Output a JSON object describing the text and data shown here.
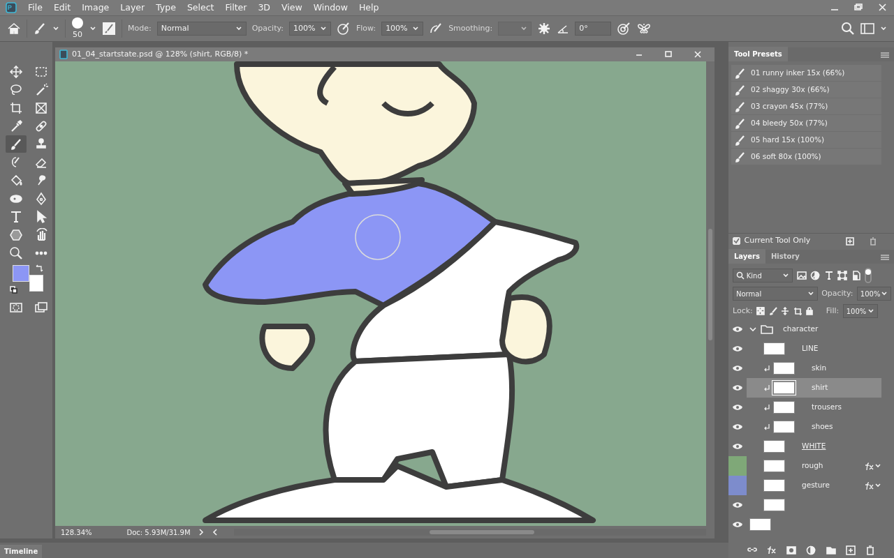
{
  "menu": [
    "File",
    "Edit",
    "Image",
    "Layer",
    "Type",
    "Select",
    "Filter",
    "3D",
    "View",
    "Window",
    "Help"
  ],
  "options": {
    "brush_size": "50",
    "mode_label": "Mode:",
    "mode": "Normal",
    "opacity_label": "Opacity:",
    "opacity": "100%",
    "flow_label": "Flow:",
    "flow": "100%",
    "smoothing_label": "Smoothing:",
    "angle": "0°"
  },
  "tools": [
    {
      "selected": false
    },
    {
      "selected": false
    },
    {
      "selected": false
    },
    {
      "selected": false
    },
    {
      "selected": false
    },
    {
      "selected": false
    },
    {
      "selected": false
    },
    {
      "selected": false
    },
    {
      "selected": true
    },
    {
      "selected": false
    },
    {
      "selected": false
    },
    {
      "selected": false
    },
    {
      "selected": false
    },
    {
      "selected": false
    },
    {
      "selected": false
    },
    {
      "selected": false
    },
    {
      "selected": false
    },
    {
      "selected": false
    },
    {
      "selected": false
    },
    {
      "selected": false
    },
    {
      "selected": false
    },
    {
      "selected": false
    }
  ],
  "swatches": [
    {
      "kind": "foreground",
      "color": "#8c96f5"
    },
    {
      "kind": "background",
      "color": "#ffffff"
    }
  ],
  "document": {
    "title": "01_04_startstate.psd @ 128% (shirt, RGB/8) *",
    "zoom": "128.34%",
    "doc_size": "Doc: 5.93M/31.9M"
  },
  "timeline": {
    "label": "Timeline"
  },
  "tool_presets": {
    "title": "Tool Presets",
    "items": [
      {
        "label": "01 runny inker 15x (66%)"
      },
      {
        "label": "02 shaggy 30x (66%)"
      },
      {
        "label": "03 crayon 45x (77%)"
      },
      {
        "label": "04 bleedy 50x (77%)"
      },
      {
        "label": "05 hard 15x (100%)"
      },
      {
        "label": "06 soft 80x (100%)"
      }
    ],
    "current_tool_only": {
      "label": "Current Tool Only",
      "checked": true
    }
  },
  "layers_panel": {
    "tabs": [
      {
        "label": "Layers",
        "selected": true
      },
      {
        "label": "History",
        "selected": false
      }
    ],
    "filter": "Kind",
    "blend_mode": "Normal",
    "opacity_label": "Opacity:",
    "opacity": "100%",
    "lock_label": "Lock:",
    "fill_label": "Fill:",
    "fill": "100%",
    "layers": [
      {
        "kind": "group",
        "name": "character",
        "visible": true,
        "expanded": true,
        "selected": false,
        "children": [
          {
            "kind": "layer",
            "name": "LINE",
            "visible": true,
            "selected": false,
            "clipped": false
          },
          {
            "kind": "layer",
            "name": "skin",
            "visible": true,
            "selected": false,
            "clipped": true
          },
          {
            "kind": "layer",
            "name": "shirt",
            "visible": true,
            "selected": true,
            "clipped": true
          },
          {
            "kind": "layer",
            "name": "trousers",
            "visible": true,
            "selected": false,
            "clipped": true
          },
          {
            "kind": "layer",
            "name": "shoes",
            "visible": true,
            "selected": false,
            "clipped": true
          },
          {
            "kind": "layer",
            "name": "WHITE",
            "visible": true,
            "selected": false,
            "clipped": false,
            "underlined": true
          },
          {
            "kind": "layer",
            "name": "rough",
            "visible": false,
            "selected": false,
            "clipped": false,
            "fx": true,
            "color": "#7fa878"
          },
          {
            "kind": "layer",
            "name": "gesture",
            "visible": false,
            "selected": false,
            "clipped": false,
            "fx": true,
            "color": "#7d8ccc"
          },
          {
            "kind": "layer",
            "visible": true,
            "selected": false,
            "clipped": false
          }
        ]
      },
      {
        "kind": "layer",
        "visible": true,
        "selected": false,
        "clipped": false
      }
    ]
  }
}
